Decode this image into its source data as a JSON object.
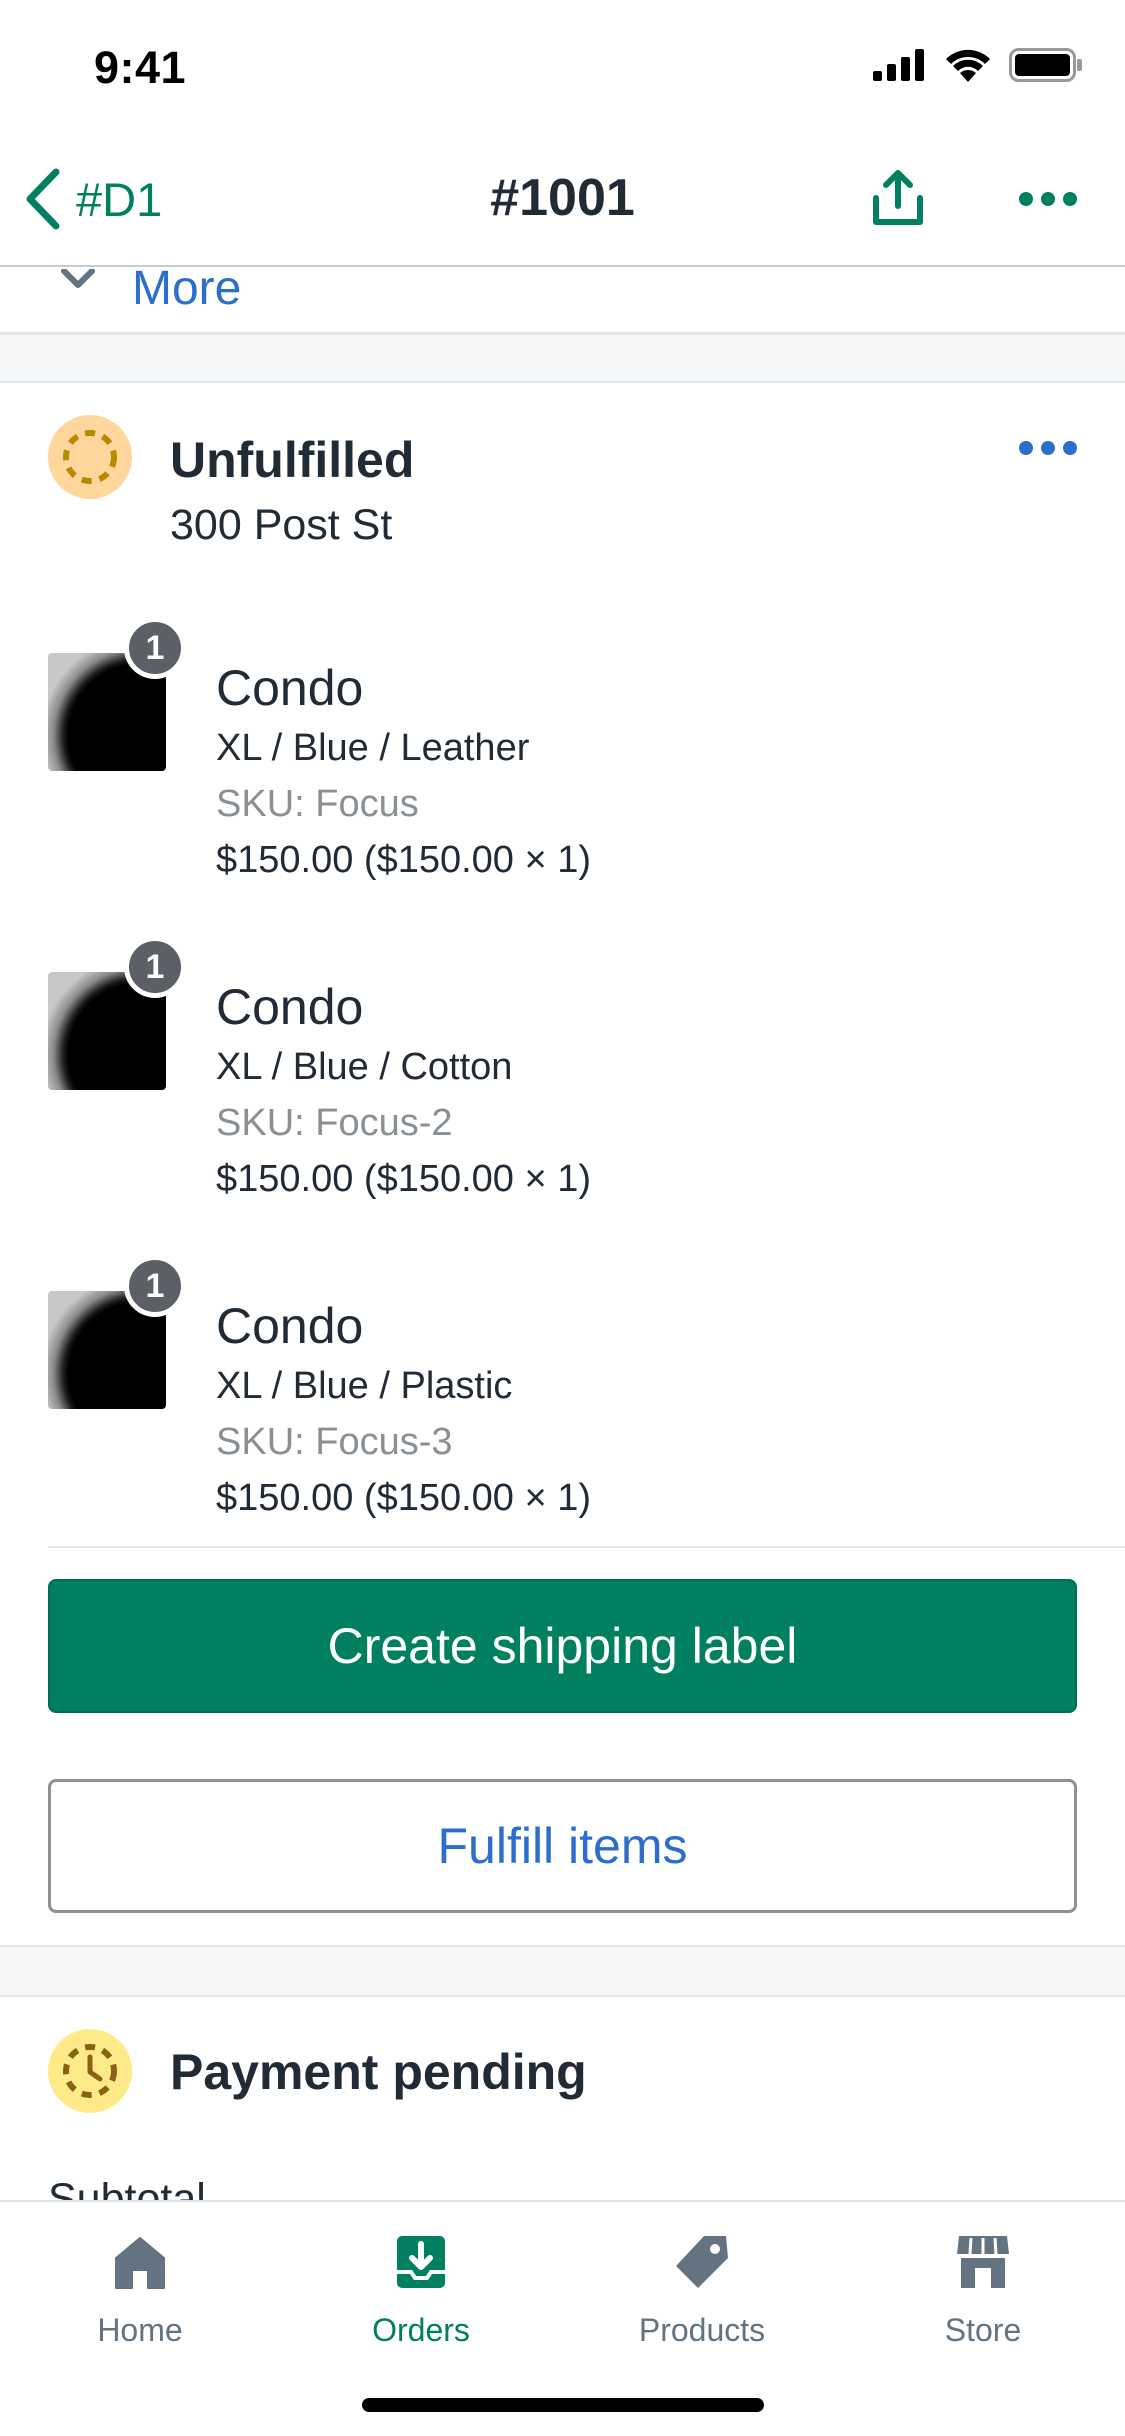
{
  "status_bar": {
    "time": "9:41"
  },
  "nav": {
    "back_label": "#D1",
    "title": "#1001"
  },
  "collapsed_section": {
    "label": "More"
  },
  "unfulfilled": {
    "title": "Unfulfilled",
    "address": "300 Post St",
    "items": [
      {
        "quantity": "1",
        "name": "Condo",
        "variant": "XL / Blue / Leather",
        "sku": "SKU: Focus",
        "price": "$150.00  ($150.00 × 1)"
      },
      {
        "quantity": "1",
        "name": "Condo",
        "variant": "XL / Blue / Cotton",
        "sku": "SKU: Focus-2",
        "price": "$150.00  ($150.00 × 1)"
      },
      {
        "quantity": "1",
        "name": "Condo",
        "variant": "XL / Blue / Plastic",
        "sku": "SKU: Focus-3",
        "price": "$150.00  ($150.00 × 1)"
      }
    ],
    "primary_action": "Create shipping label",
    "secondary_action": "Fulfill items"
  },
  "payment": {
    "title": "Payment pending",
    "subtotal_label": "Subtotal"
  },
  "tab_bar": {
    "tabs": [
      {
        "label": "Home",
        "icon": "home-icon",
        "active": false
      },
      {
        "label": "Orders",
        "icon": "orders-icon",
        "active": true
      },
      {
        "label": "Products",
        "icon": "tag-icon",
        "active": false
      },
      {
        "label": "Store",
        "icon": "store-icon",
        "active": false
      }
    ]
  },
  "colors": {
    "primary": "#008060",
    "link": "#2c6ecb",
    "warning_bg": "#ffd79d",
    "pending_bg": "#ffea8a"
  }
}
